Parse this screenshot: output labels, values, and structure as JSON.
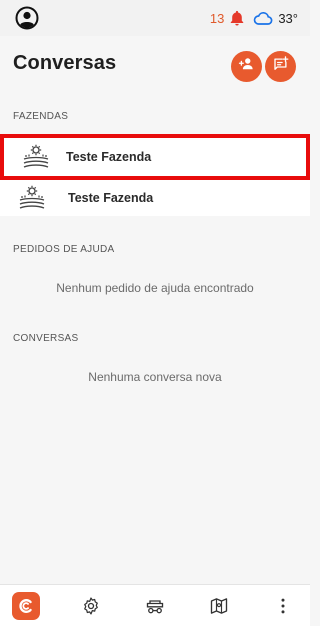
{
  "status_bar": {
    "notification_count": "13",
    "temperature": "33°",
    "icons": [
      "user-circle-icon",
      "bell-icon",
      "cloud-icon"
    ]
  },
  "header": {
    "title": "Conversas",
    "actions": [
      "add-user-icon",
      "new-chat-icon"
    ]
  },
  "farms": {
    "section_label": "FAZENDAS",
    "items": [
      {
        "name": "Teste Fazenda",
        "icon": "farm-field-icon",
        "selected": true
      },
      {
        "name": "Teste Fazenda",
        "icon": "farm-field-icon",
        "selected": false
      }
    ]
  },
  "help_requests": {
    "section_label": "PEDIDOS DE AJUDA",
    "empty_message": "Nenhum pedido de ajuda encontrado"
  },
  "conversations": {
    "section_label": "CONVERSAS",
    "empty_message": "Nenhuma conversa nova"
  },
  "bottom_nav": {
    "icons": [
      "app-logo-icon",
      "settings-gear-icon",
      "machinery-icon",
      "map-icon",
      "more-vertical-icon"
    ]
  },
  "colors": {
    "accent": "#e85a2e",
    "selection_border": "#e80c0c",
    "weather_icon": "#1a73e8"
  }
}
